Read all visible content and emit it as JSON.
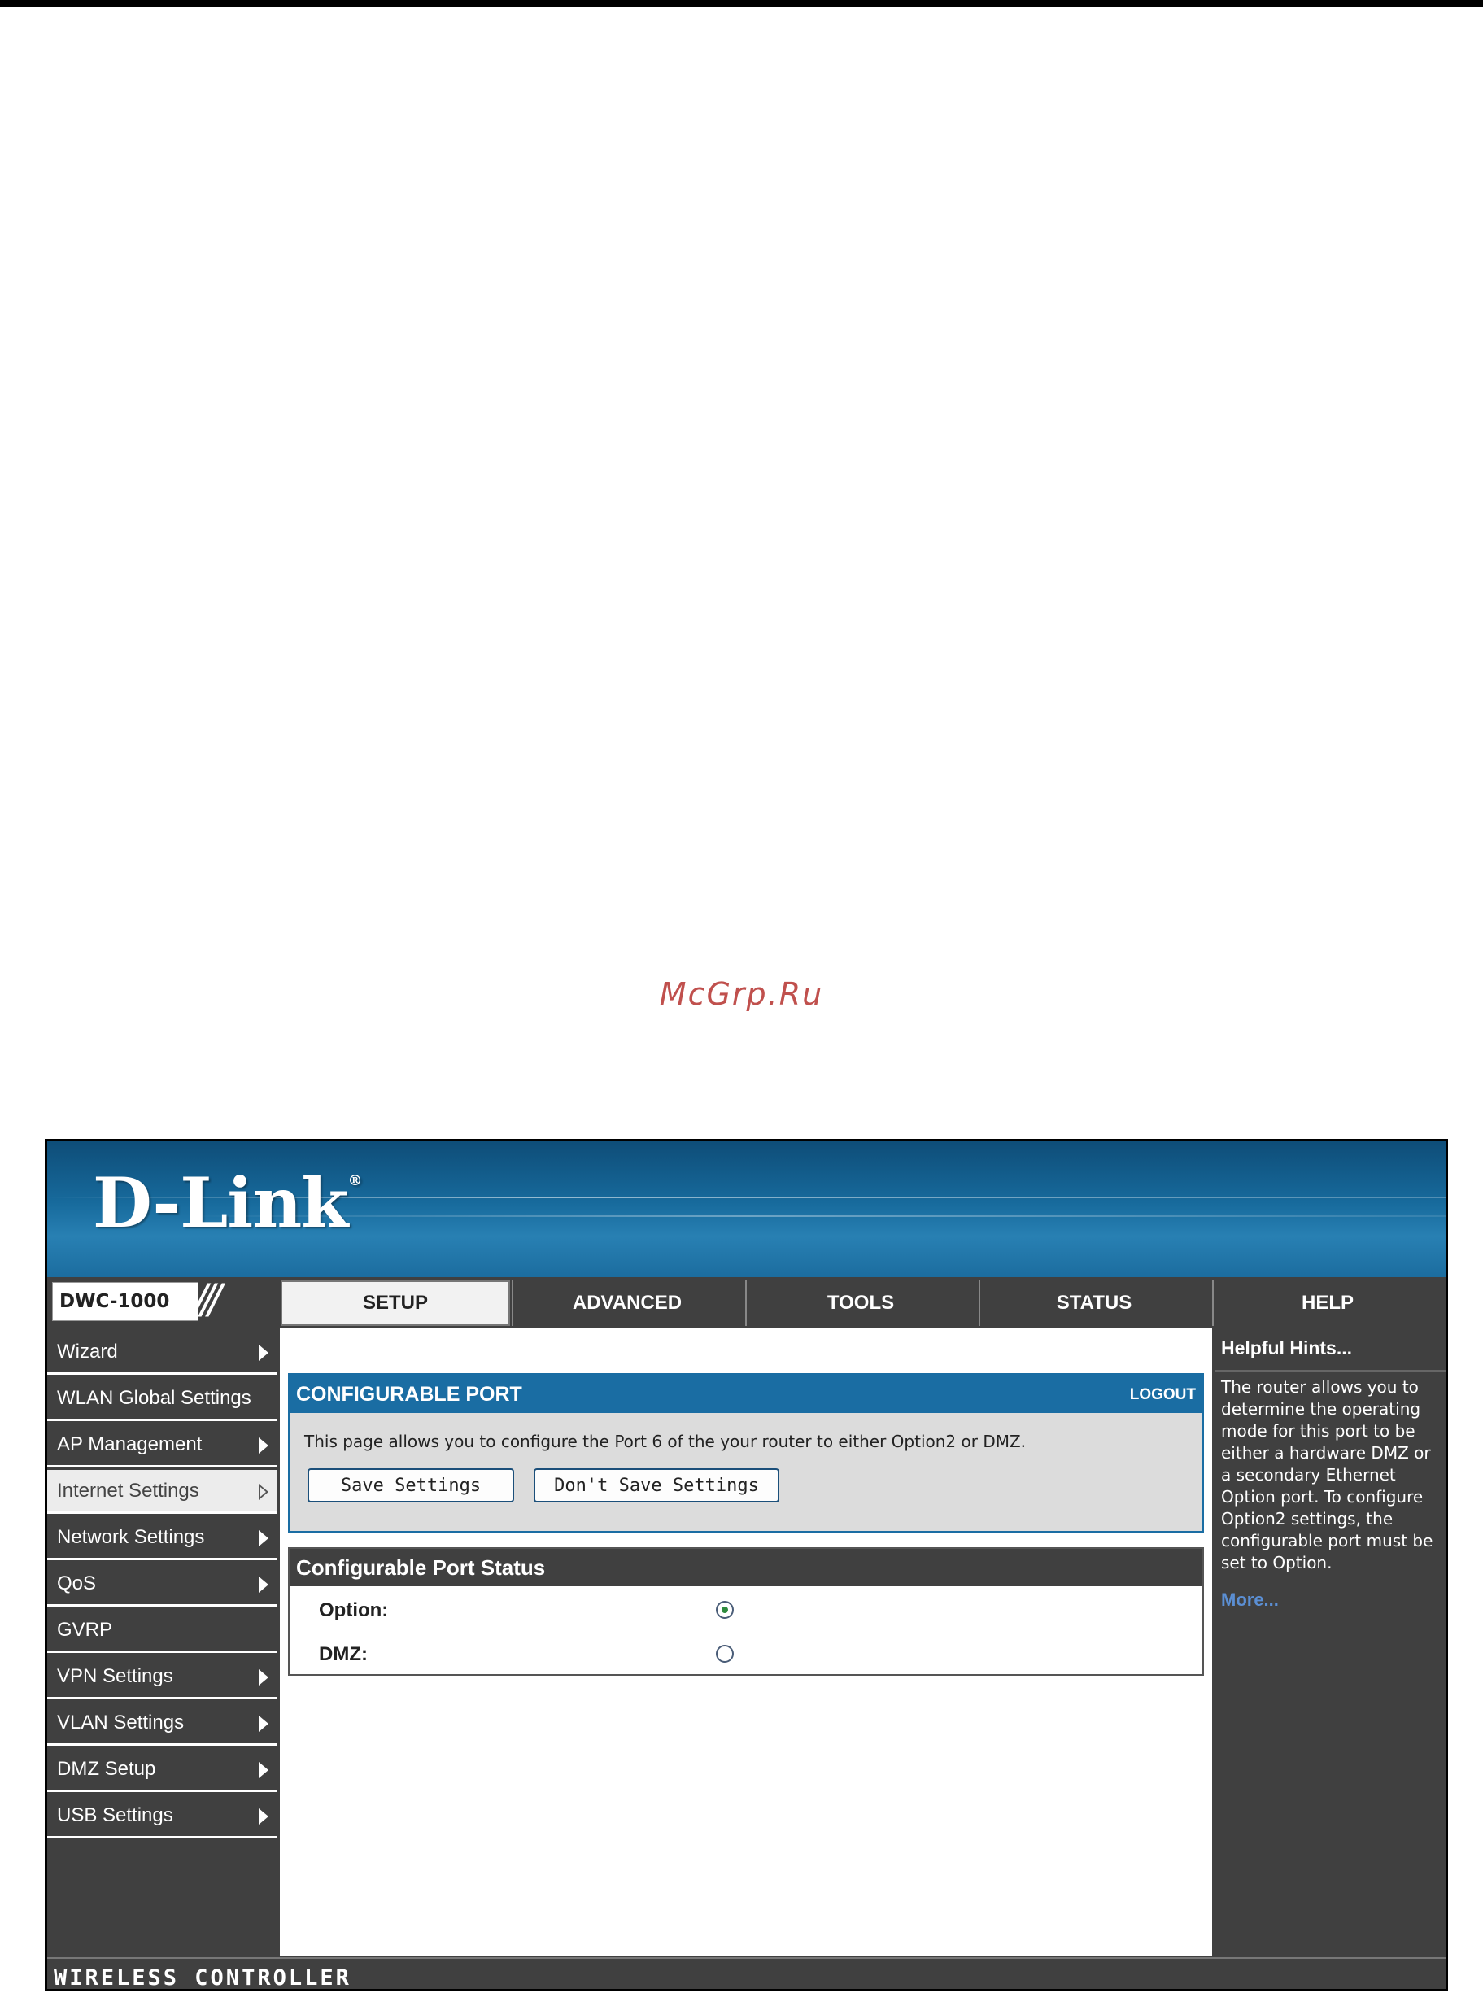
{
  "watermark": "McGrp.Ru",
  "brand": {
    "logo": "D-Link",
    "registered": "®"
  },
  "model": {
    "name": "DWC-1000",
    "slashes": "///"
  },
  "tabs": [
    {
      "label": "SETUP",
      "active": true
    },
    {
      "label": "ADVANCED",
      "active": false
    },
    {
      "label": "TOOLS",
      "active": false
    },
    {
      "label": "STATUS",
      "active": false
    },
    {
      "label": "HELP",
      "active": false
    }
  ],
  "sidebar": {
    "items": [
      {
        "label": "Wizard",
        "has_arrow": true
      },
      {
        "label": "WLAN Global Settings",
        "has_arrow": false
      },
      {
        "label": "AP Management",
        "has_arrow": true
      },
      {
        "label": "Internet Settings",
        "has_arrow": true,
        "active": true
      },
      {
        "label": "Network Settings",
        "has_arrow": true
      },
      {
        "label": "QoS",
        "has_arrow": true
      },
      {
        "label": "GVRP",
        "has_arrow": false
      },
      {
        "label": "VPN Settings",
        "has_arrow": true
      },
      {
        "label": "VLAN Settings",
        "has_arrow": true
      },
      {
        "label": "DMZ Setup",
        "has_arrow": true
      },
      {
        "label": "USB Settings",
        "has_arrow": true
      }
    ]
  },
  "main": {
    "panel_title": "CONFIGURABLE PORT",
    "logout": "LOGOUT",
    "description": "This page allows you to configure the Port 6 of the your router to either Option2 or DMZ.",
    "save_button": "Save Settings",
    "dont_save_button": "Don't Save Settings",
    "status_title": "Configurable Port Status",
    "options": [
      {
        "label": "Option:",
        "checked": true
      },
      {
        "label": "DMZ:",
        "checked": false
      }
    ]
  },
  "help": {
    "title": "Helpful Hints...",
    "text": "The router allows you to determine the operating mode for this port to be either a hardware DMZ or a secondary Ethernet Option port. To configure Option2 settings, the configurable port must be set to Option.",
    "more": "More..."
  },
  "footer": {
    "text": "WIRELESS CONTROLLER"
  },
  "colors": {
    "accent_blue": "#1a6da3",
    "dark_gray": "#404040",
    "link_blue": "#5b8fd4",
    "watermark_red": "#c0504d"
  }
}
